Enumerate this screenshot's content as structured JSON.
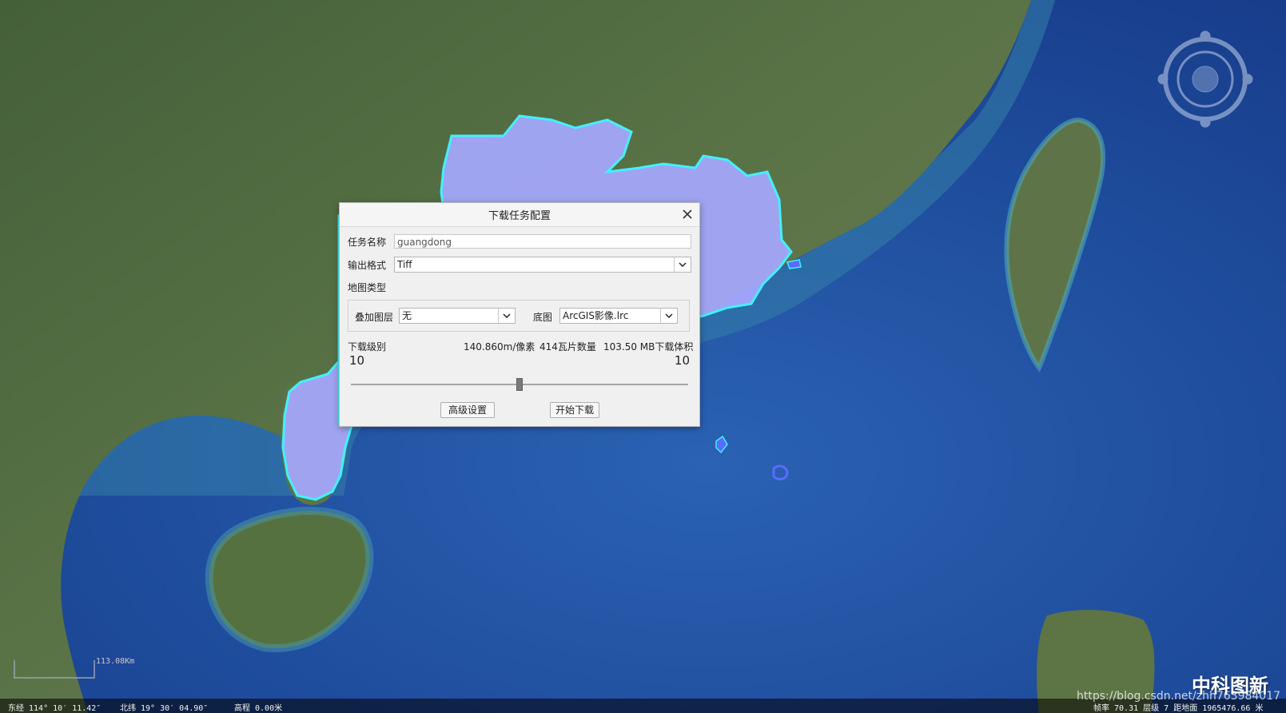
{
  "dialog": {
    "title": "下载任务配置",
    "task_name_label": "任务名称",
    "task_name_value": "guangdong",
    "output_format_label": "输出格式",
    "output_format_value": "Tiff",
    "map_type_label": "地图类型",
    "overlay_label": "叠加图层",
    "overlay_value": "无",
    "basemap_label": "底图",
    "basemap_value": "ArcGIS影像.lrc",
    "level_label": "下载级别",
    "resolution": "140.860m/像素",
    "tile_count": "414瓦片数量",
    "volume": "103.50 MB下载体积",
    "level_min": "10",
    "level_max": "10",
    "slider_level": 0.5,
    "advanced_button": "高级设置",
    "start_button": "开始下载"
  },
  "map": {
    "scale_text": "113.08Km",
    "status_left": {
      "lon": "东经 114° 10′ 11.42″",
      "lat": "北纬 19° 30′ 04.90″",
      "alt": "高程 0.00米"
    },
    "status_right": "帧率 70.31  层级 7  距地面 1965476.66 米",
    "brand": "中科图新",
    "watermark": "https://blog.csdn.net/zhh763984017"
  },
  "colors": {
    "ocean_deep": "#173c8a",
    "ocean_mid": "#2a5fae",
    "ocean_shallow": "#3f8fae",
    "land": "#4f6b3a",
    "land_light": "#7a8a5a",
    "selection_fill": "#a9a9ff",
    "selection_border": "#3ef0ff"
  }
}
